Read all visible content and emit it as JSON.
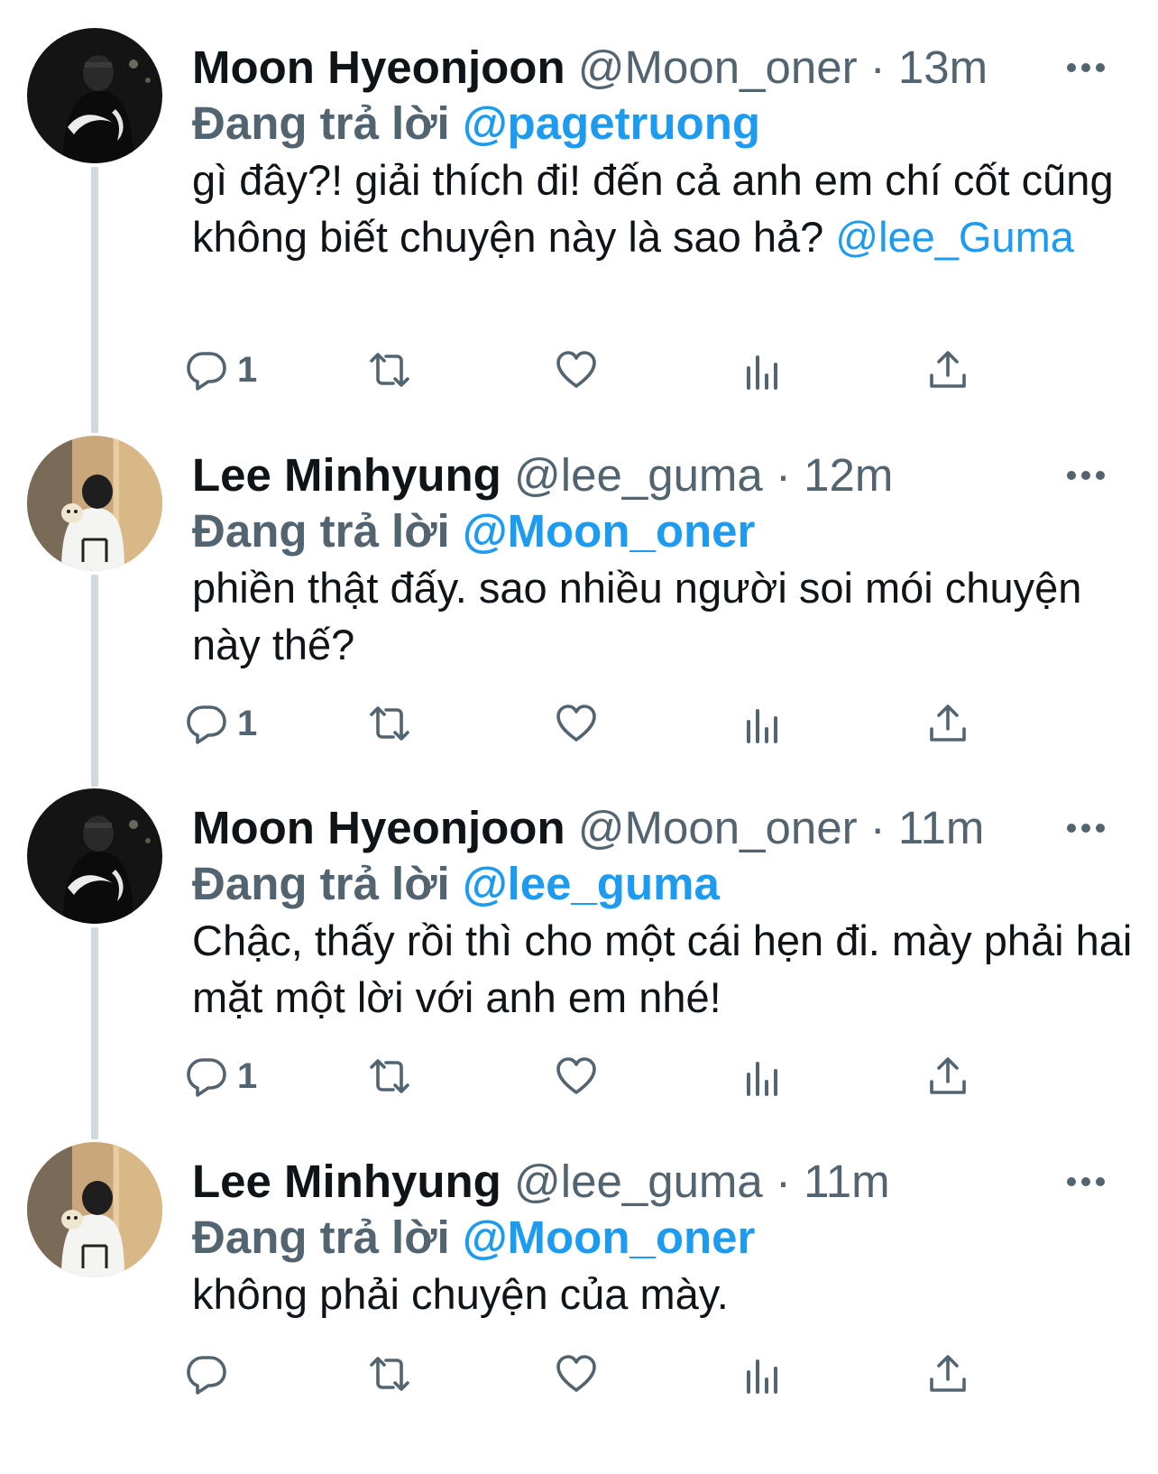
{
  "colors": {
    "accent": "#1d9bf0",
    "secondary_text": "#536471",
    "primary_text": "#0f1419",
    "thread_line": "#cfd9de"
  },
  "reply_prefix": "Đang trả lời",
  "tweets": [
    {
      "name": "Moon Hyeonjoon",
      "handle": "@Moon_oner",
      "separator": "·",
      "time": "13m",
      "reply_to": "@pagetruong",
      "body_text": "gì đây?! giải thích đi! đến cả anh em chí cốt cũng không biết chuyện này là sao hả? ",
      "body_mention": "@lee_Guma",
      "reply_count": "1",
      "avatar_icon": "avatar-dark-photo"
    },
    {
      "name": "Lee Minhyung",
      "handle": "@lee_guma",
      "separator": "·",
      "time": "12m",
      "reply_to": "@Moon_oner",
      "body_text": "phiền thật đấy. sao nhiều người soi mói chuyện này thế?",
      "body_mention": "",
      "reply_count": "1",
      "avatar_icon": "avatar-light-photo"
    },
    {
      "name": "Moon Hyeonjoon",
      "handle": "@Moon_oner",
      "separator": "·",
      "time": "11m",
      "reply_to": "@lee_guma",
      "body_text": "Chậc, thấy rồi thì cho một cái hẹn đi. mày phải hai mặt một lời với anh em nhé!",
      "body_mention": "",
      "reply_count": "1",
      "avatar_icon": "avatar-dark-photo"
    },
    {
      "name": "Lee Minhyung",
      "handle": "@lee_guma",
      "separator": "·",
      "time": "11m",
      "reply_to": "@Moon_oner",
      "body_text": "không phải chuyện của mày.",
      "body_mention": "",
      "reply_count": "",
      "avatar_icon": "avatar-light-photo"
    }
  ]
}
